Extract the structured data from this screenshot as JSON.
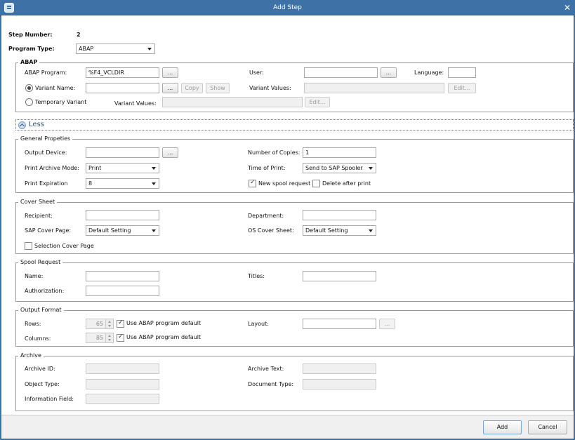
{
  "window": {
    "title": "Add Step"
  },
  "step": {
    "number_label": "Step Number:",
    "number_value": "2",
    "type_label": "Program Type:",
    "type_value": "ABAP"
  },
  "abap": {
    "title": "ABAP",
    "program_label": "ABAP Program:",
    "program_value": "%F4_VCLDIR",
    "user_label": "User:",
    "language_label": "Language:",
    "variant_name_label": "Variant Name:",
    "copy_label": "Copy",
    "show_label": "Show",
    "variant_values_label": "Variant Values:",
    "edit_label": "Edit...",
    "temp_variant_label": "Temporary Variant",
    "temp_values_label": "Variant Values:",
    "browse_label": "..."
  },
  "less_label": "Less",
  "general": {
    "title": "General Propeties",
    "output_device_label": "Output Device:",
    "copies_label": "Number of Copies:",
    "copies_value": "1",
    "archive_mode_label": "Print Archive Mode:",
    "archive_mode_value": "Print",
    "time_label": "Time of Print:",
    "time_value": "Send to SAP Spooler",
    "expiration_label": "Print Expiration",
    "expiration_value": "8",
    "new_spool_label": "New spool request",
    "delete_after_label": "Delete after print"
  },
  "cover": {
    "title": "Cover Sheet",
    "recipient_label": "Recipient:",
    "department_label": "Department:",
    "sap_cover_label": "SAP Cover Page:",
    "sap_cover_value": "Default Setting",
    "os_cover_label": "OS Cover Sheet:",
    "os_cover_value": "Default Setting",
    "selection_label": "Selection Cover Page"
  },
  "spool": {
    "title": "Spool Request",
    "name_label": "Name:",
    "titles_label": "Titles:",
    "auth_label": "Authorization:"
  },
  "output_format": {
    "title": "Output Format",
    "rows_label": "Rows:",
    "rows_value": "65",
    "columns_label": "Columns:",
    "columns_value": "85",
    "default_label": "Use ABAP program default",
    "layout_label": "Layout:"
  },
  "archive": {
    "title": "Archive",
    "id_label": "Archive ID:",
    "text_label": "Archive Text:",
    "object_label": "Object Type:",
    "doc_label": "Document Type:",
    "info_label": "Information Field:"
  },
  "footer": {
    "add_label": "Add",
    "cancel_label": "Cancel"
  }
}
